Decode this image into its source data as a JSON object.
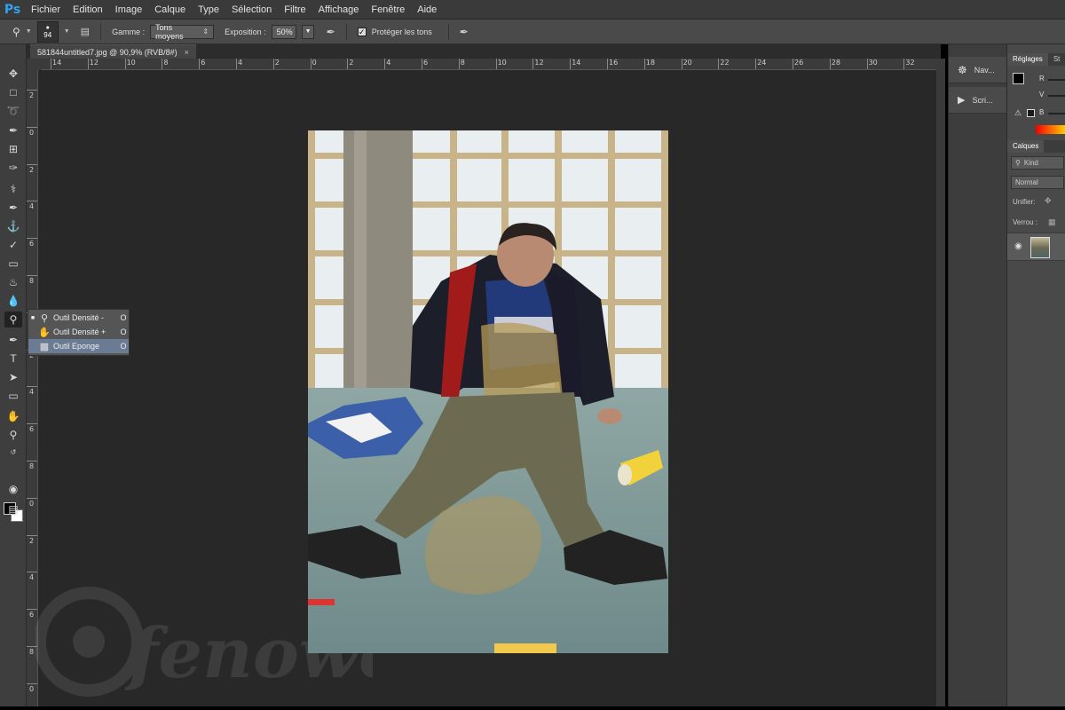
{
  "app": {
    "logo": "Ps"
  },
  "menu": [
    "Fichier",
    "Edition",
    "Image",
    "Calque",
    "Type",
    "Sélection",
    "Filtre",
    "Affichage",
    "Fenêtre",
    "Aide"
  ],
  "options": {
    "brush_size": "94",
    "gamme_label": "Gamme :",
    "gamme_value": "Tons moyens",
    "exposition_label": "Exposition :",
    "exposition_value": "50%",
    "protect_label": "Protéger les tons",
    "protect_checked": true
  },
  "document": {
    "tab_title": "581844untitled7.jpg @ 90,9% (RVB/8#)",
    "close": "×"
  },
  "rulers": {
    "h_labels": [
      "14",
      "12",
      "10",
      "8",
      "6",
      "4",
      "2",
      "0",
      "2",
      "4",
      "6",
      "8",
      "10",
      "12",
      "14",
      "16",
      "18",
      "20",
      "22",
      "24",
      "26",
      "28",
      "30",
      "32"
    ],
    "v_labels": [
      "2",
      "0",
      "2",
      "4",
      "6",
      "8",
      "1",
      "2",
      "4",
      "6",
      "8",
      "0",
      "2",
      "4",
      "6",
      "8",
      "0"
    ]
  },
  "flyout": {
    "items": [
      {
        "label": "Outil Densité -",
        "key": "O",
        "icon": "dodge-icon",
        "current": true
      },
      {
        "label": "Outil Densité +",
        "key": "O",
        "icon": "burn-icon",
        "current": false
      },
      {
        "label": "Outil Eponge",
        "key": "O",
        "icon": "sponge-icon",
        "current": false,
        "highlighted": true
      }
    ]
  },
  "dock": {
    "navigator": "Nav...",
    "scripts": "Scri..."
  },
  "panels": {
    "tab_reglages": "Réglages",
    "tab_styles": "St",
    "color_r": "R",
    "color_v": "V",
    "color_b": "B",
    "layers_tab": "Calques",
    "kind_placeholder": "Kind",
    "blend_mode": "Normal",
    "unify_label": "Unifier:",
    "lock_label": "Verrou :"
  },
  "colors": {
    "foreground": "#000000",
    "background": "#ffffff",
    "accent": "#2fa3ee",
    "highlight": "#6c7b94"
  },
  "watermark_text": "fenoweb"
}
